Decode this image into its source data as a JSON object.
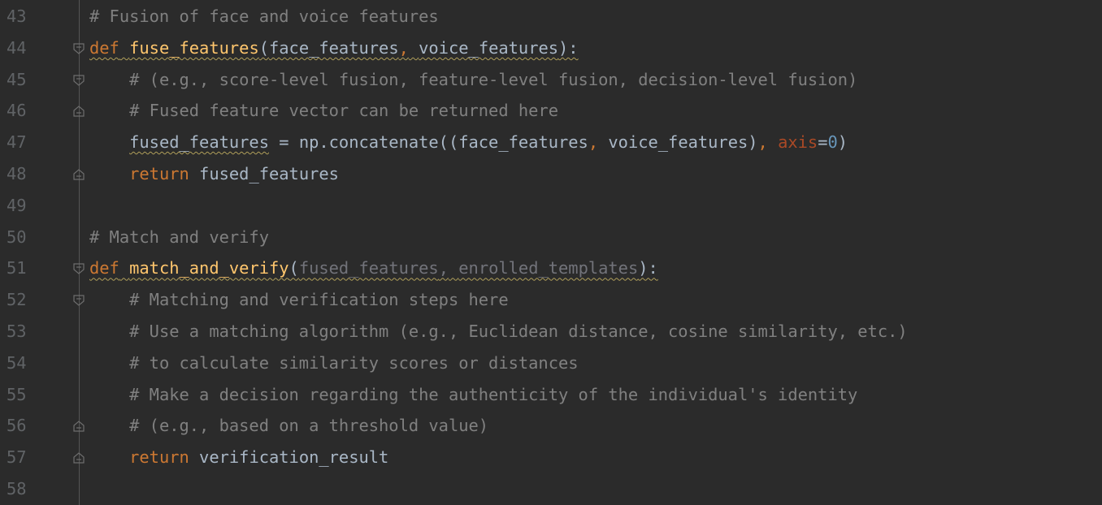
{
  "editor": {
    "lines": [
      {
        "num": "43",
        "indent": "",
        "tokens": [
          {
            "t": "# Fusion of face and voice features",
            "c": "comment"
          }
        ]
      },
      {
        "num": "44",
        "indent": "",
        "fold": "open",
        "tokens": [
          {
            "t": "def",
            "c": "kw sq"
          },
          {
            "t": " ",
            "c": "sq"
          },
          {
            "t": "fuse_features",
            "c": "fn sq"
          },
          {
            "t": "(",
            "c": "sq"
          },
          {
            "t": "face_features",
            "c": "param sq"
          },
          {
            "t": ",",
            "c": "kw sq"
          },
          {
            "t": " ",
            "c": "sq"
          },
          {
            "t": "voice_features",
            "c": "param sq"
          },
          {
            "t": "):",
            "c": "sq"
          }
        ]
      },
      {
        "num": "45",
        "indent": "    ",
        "fold": "open",
        "tokens": [
          {
            "t": "# (e.g., score-level fusion, feature-level fusion, decision-level fusion)",
            "c": "comment"
          }
        ]
      },
      {
        "num": "46",
        "indent": "    ",
        "fold": "close",
        "tokens": [
          {
            "t": "# Fused feature vector can be returned here",
            "c": "comment"
          }
        ]
      },
      {
        "num": "47",
        "indent": "    ",
        "tokens": [
          {
            "t": "fused_features",
            "c": "sq"
          },
          {
            "t": " = np.concatenate((face_features",
            "c": ""
          },
          {
            "t": ",",
            "c": "kw"
          },
          {
            "t": " voice_features)",
            "c": ""
          },
          {
            "t": ",",
            "c": "kw"
          },
          {
            "t": " ",
            "c": ""
          },
          {
            "t": "axis",
            "c": "kwarg"
          },
          {
            "t": "=",
            "c": ""
          },
          {
            "t": "0",
            "c": "num"
          },
          {
            "t": ")",
            "c": ""
          }
        ]
      },
      {
        "num": "48",
        "indent": "    ",
        "fold": "close",
        "tokens": [
          {
            "t": "return",
            "c": "kw"
          },
          {
            "t": " fused_features",
            "c": ""
          }
        ]
      },
      {
        "num": "49",
        "indent": "",
        "tokens": []
      },
      {
        "num": "50",
        "indent": "",
        "tokens": [
          {
            "t": "# Match and verify",
            "c": "comment"
          }
        ]
      },
      {
        "num": "51",
        "indent": "",
        "fold": "open",
        "tokens": [
          {
            "t": "def",
            "c": "kw sq"
          },
          {
            "t": " ",
            "c": "sq"
          },
          {
            "t": "match_and_verify",
            "c": "fn sq"
          },
          {
            "t": "(",
            "c": "sq"
          },
          {
            "t": "fused_features",
            "c": "param-unused sq"
          },
          {
            "t": ",",
            "c": "param-unused sq"
          },
          {
            "t": " ",
            "c": "sq"
          },
          {
            "t": "enrolled_templates",
            "c": "param-unused sq"
          },
          {
            "t": "):",
            "c": "sq"
          }
        ]
      },
      {
        "num": "52",
        "indent": "    ",
        "fold": "open",
        "tokens": [
          {
            "t": "# Matching and verification steps here",
            "c": "comment"
          }
        ]
      },
      {
        "num": "53",
        "indent": "    ",
        "tokens": [
          {
            "t": "# Use a matching algorithm (e.g., Euclidean distance, cosine similarity, etc.)",
            "c": "comment"
          }
        ]
      },
      {
        "num": "54",
        "indent": "    ",
        "tokens": [
          {
            "t": "# to calculate similarity scores or distances",
            "c": "comment"
          }
        ]
      },
      {
        "num": "55",
        "indent": "    ",
        "tokens": [
          {
            "t": "# Make a decision regarding the authenticity of the individual's identity",
            "c": "comment"
          }
        ]
      },
      {
        "num": "56",
        "indent": "    ",
        "fold": "close",
        "tokens": [
          {
            "t": "# (e.g., based on a threshold value)",
            "c": "comment"
          }
        ]
      },
      {
        "num": "57",
        "indent": "    ",
        "fold": "close",
        "tokens": [
          {
            "t": "return",
            "c": "kw"
          },
          {
            "t": " verification_result",
            "c": ""
          }
        ]
      },
      {
        "num": "58",
        "indent": "",
        "tokens": []
      }
    ]
  }
}
